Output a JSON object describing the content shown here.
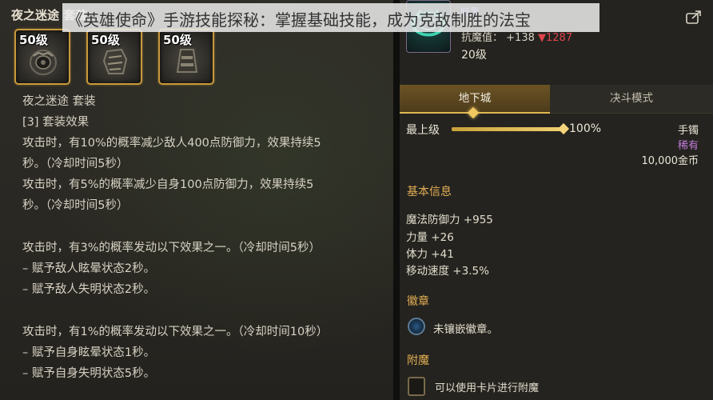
{
  "overlay": {
    "title": "《英雄使命》手游技能探秘：掌握基础技能，成为克敌制胜的法宝"
  },
  "left": {
    "set_header": "夜之迷途 套装",
    "items": [
      {
        "level": "50级",
        "icon": "bracelet-icon"
      },
      {
        "level": "50级",
        "icon": "gauntlet-icon"
      },
      {
        "level": "50级",
        "icon": "bracer-icon"
      }
    ],
    "set_name": "夜之迷途  套装",
    "set_effect_header": "[3] 套装效果",
    "lines": [
      "攻击时，有10%的概率减少敌人400点防御力，效果持续5",
      "秒。（冷却时间5秒）",
      "攻击时，有5%的概率减少自身100点防御力，效果持续5",
      "秒。（冷却时间5秒）",
      "攻击时，有3%的概率发动以下效果之一。（冷却时间5秒）",
      "– 赋予敌人眩晕状态2秒。",
      "– 赋予敌人失明状态2秒。",
      "攻击时，有1%的概率发动以下效果之一。（冷却时间10秒）",
      "– 赋予自身眩晕状态1秒。",
      "– 赋予自身失明状态5秒。"
    ]
  },
  "right": {
    "grade_tag": "暗黑",
    "resist_prefix": "抗魔值：",
    "resist_plus": "+138",
    "resist_minus": "▼1287",
    "item_level": "20级",
    "tabs": [
      {
        "label": "地下城",
        "active": true
      },
      {
        "label": "决斗模式",
        "active": false
      }
    ],
    "upgrade_label": "最上级",
    "upgrade_progress": 1.0,
    "upgrade_pct": "100%",
    "item_type": "手镯",
    "rarity": "稀有",
    "price": "10,000金币",
    "basic_info_title": "基本信息",
    "stats": [
      "魔法防御力 +955",
      "力量 +26",
      "体力 +41",
      "移动速度 +3.5%"
    ],
    "emblem_title": "徽章",
    "emblem_text": "未镶嵌徽章。",
    "enchant_title": "附魔",
    "enchant_text": "可以使用卡片进行附魔"
  },
  "colors": {
    "accent_gold": "#e2ae54",
    "rarity_purple": "#c07bd8",
    "negative_red": "#e0454a",
    "slot_border": "#c89a3a"
  }
}
